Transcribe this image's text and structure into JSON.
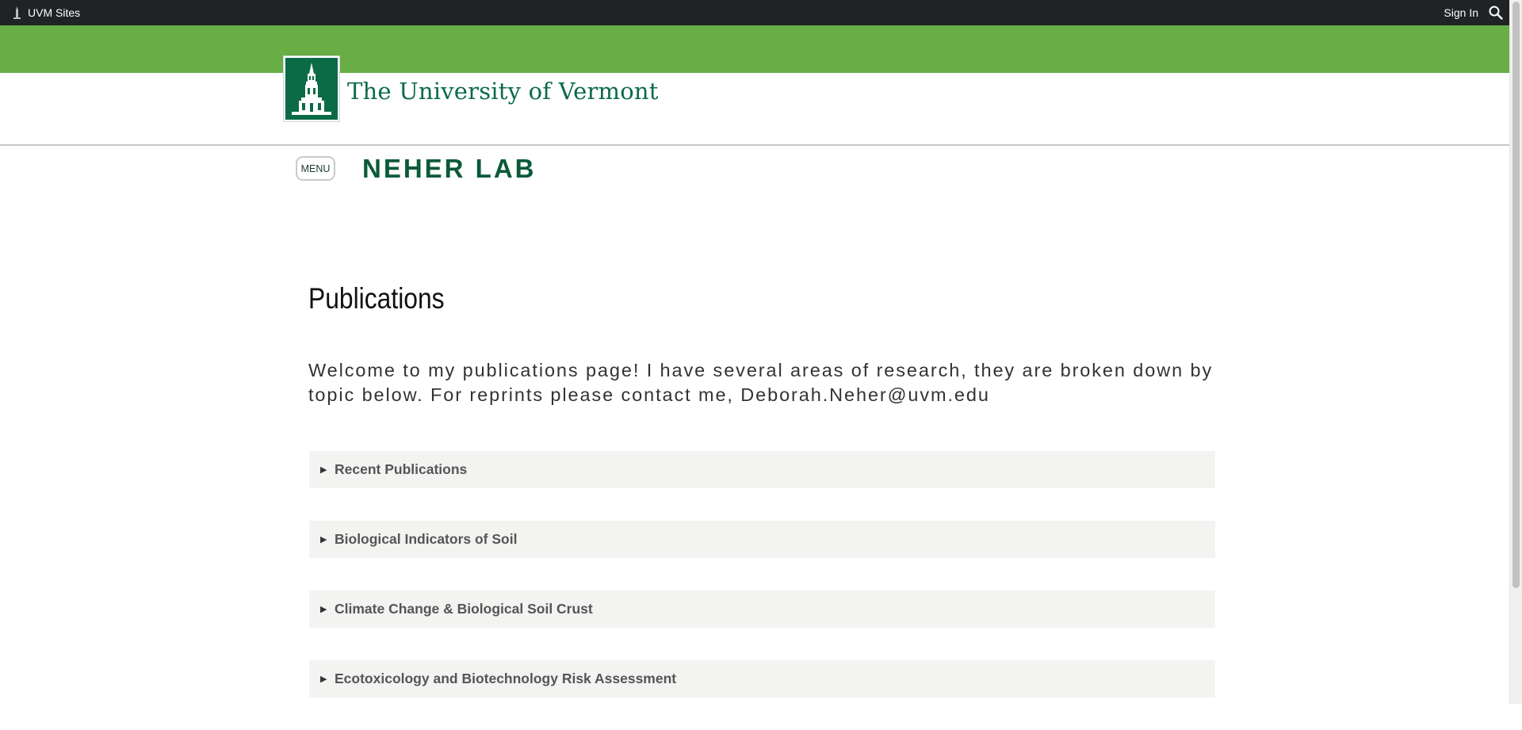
{
  "topbar": {
    "sites_label": "UVM Sites",
    "signin_label": "Sign In",
    "search_icon": "search-icon"
  },
  "header": {
    "wordmark": "The University of Vermont"
  },
  "site": {
    "menu_label": "MENU",
    "title": "NEHER LAB"
  },
  "page": {
    "title": "Publications",
    "intro": "Welcome to my publications page! I have several areas of research, they are broken down by topic below. For reprints please contact me, Deborah.Neher@uvm.edu"
  },
  "accordions": [
    {
      "label": "Recent Publications"
    },
    {
      "label": "Biological Indicators of Soil"
    },
    {
      "label": "Climate Change & Biological Soil Crust"
    },
    {
      "label": "Ecotoxicology and Biotechnology Risk Assessment"
    }
  ],
  "colors": {
    "topbar_bg": "#1f2326",
    "green_band": "#68ad45",
    "uvm_green": "#0b6b47"
  }
}
